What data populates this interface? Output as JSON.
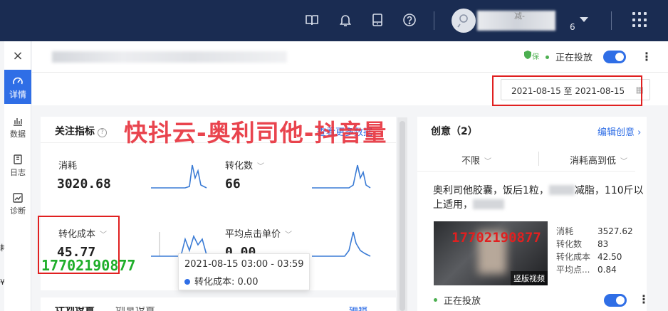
{
  "topbar": {
    "icons": [
      "book-icon",
      "bell-icon",
      "tablet-icon",
      "help-icon"
    ],
    "user": {
      "name_fragment": "减-",
      "id_suffix": "6"
    }
  },
  "rail": {
    "close": "×",
    "items": [
      {
        "label": "详情",
        "icon": "speedometer-icon",
        "active": true
      },
      {
        "label": "数据",
        "icon": "bar-chart-icon"
      },
      {
        "label": "日志",
        "icon": "log-icon"
      },
      {
        "label": "诊断",
        "icon": "trend-icon"
      }
    ],
    "edge_chars": [
      "耗",
      "¥"
    ]
  },
  "header": {
    "badge": "保",
    "status": "正在投放",
    "toggle_on": true
  },
  "date_range": {
    "value": "2021-08-15 至 2021-08-15"
  },
  "metrics_panel": {
    "title": "关注指标",
    "link": "查看更多数据",
    "metrics": [
      {
        "label": "消耗",
        "value": "3020.68"
      },
      {
        "label": "转化数",
        "value": "66"
      },
      {
        "label": "转化成本",
        "value": "45.77"
      },
      {
        "label": "平均点击单价",
        "value": "0.00"
      }
    ],
    "tooltip": {
      "time": "2021-08-15 03:00 - 03:59",
      "series": "转化成本",
      "value": "0.00"
    },
    "bottom_tabs": [
      "计划设置",
      "创意设置"
    ],
    "bottom_link": "编辑"
  },
  "overlays": {
    "watermark": "快抖云-奥利司他-抖音量",
    "phone_green": "17702190877",
    "phone_red": "17702190877"
  },
  "creative_panel": {
    "title": "创意（2）",
    "edit_link": "编辑创意",
    "filters": [
      "不限",
      "消耗高到低"
    ],
    "text_a": "奥利司他胶囊，饭后1粒，",
    "text_b": "减脂，110斤以上适用，",
    "video_tag": "竖版视频",
    "stats": [
      {
        "k": "消耗",
        "v": "3527.62"
      },
      {
        "k": "转化数",
        "v": "83"
      },
      {
        "k": "转化成本",
        "v": "42.50"
      },
      {
        "k": "平均点...",
        "v": "0.84"
      }
    ],
    "status": "正在投放"
  }
}
